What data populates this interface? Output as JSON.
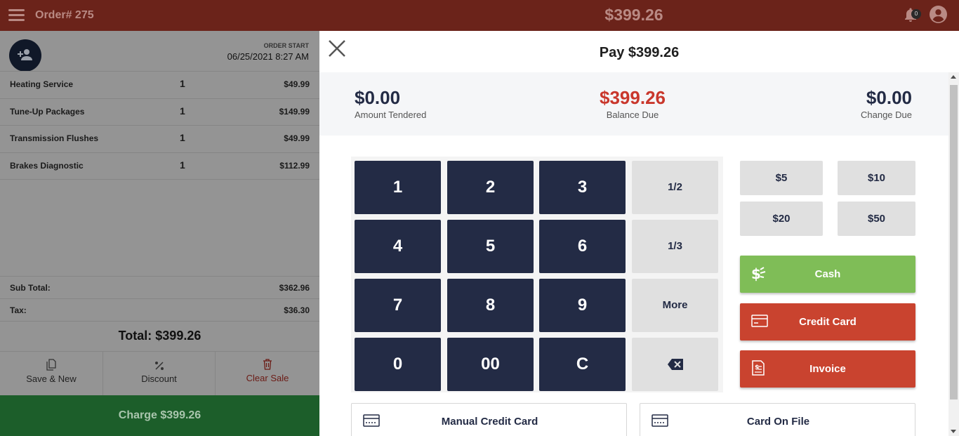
{
  "header": {
    "order_number": "Order# 275",
    "total": "$399.26",
    "notification_count": "0",
    "icons": [
      "menu-icon",
      "bell-icon",
      "user-icon"
    ]
  },
  "order": {
    "order_start_label": "ORDER START",
    "order_start_value": "06/25/2021 8:27 AM",
    "items": [
      {
        "name": "Heating Service",
        "qty": "1",
        "price": "$49.99"
      },
      {
        "name": "Tune-Up Packages",
        "qty": "1",
        "price": "$149.99"
      },
      {
        "name": "Transmission Flushes",
        "qty": "1",
        "price": "$49.99"
      },
      {
        "name": "Brakes Diagnostic",
        "qty": "1",
        "price": "$112.99"
      }
    ],
    "subtotal_label": "Sub Total:",
    "subtotal_value": "$362.96",
    "tax_label": "Tax:",
    "tax_value": "$36.30",
    "total_label": "Total: $399.26",
    "actions": {
      "save_new": "Save & New",
      "discount": "Discount",
      "clear_sale": "Clear Sale"
    },
    "charge_label": "Charge $399.26"
  },
  "payment": {
    "title": "Pay $399.26",
    "amount_tendered": {
      "value": "$0.00",
      "label": "Amount Tendered"
    },
    "balance_due": {
      "value": "$399.26",
      "label": "Balance Due"
    },
    "change_due": {
      "value": "$0.00",
      "label": "Change Due"
    },
    "keys": {
      "k1": "1",
      "k2": "2",
      "k3": "3",
      "half": "1/2",
      "k4": "4",
      "k5": "5",
      "k6": "6",
      "third": "1/3",
      "k7": "7",
      "k8": "8",
      "k9": "9",
      "more": "More",
      "k0": "0",
      "k00": "00",
      "clear": "C"
    },
    "quick_amounts": {
      "q5": "$5",
      "q10": "$10",
      "q20": "$20",
      "q50": "$50"
    },
    "methods": {
      "cash": "Cash",
      "credit_card": "Credit Card",
      "invoice": "Invoice",
      "manual_credit_card": "Manual Credit Card",
      "card_on_file": "Card On File"
    }
  },
  "colors": {
    "topbar": "#6b231a",
    "navy": "#232b45",
    "cash_green": "#7fbd57",
    "red": "#c9432f",
    "charge_green": "#1c5e2a"
  }
}
